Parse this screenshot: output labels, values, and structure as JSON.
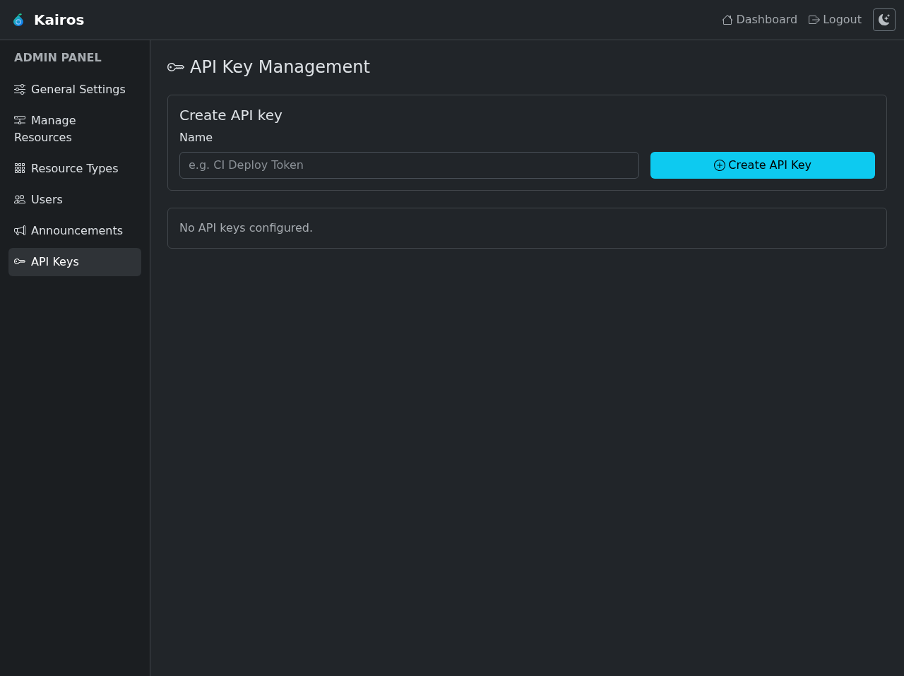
{
  "navbar": {
    "brand": "Kairos",
    "links": [
      {
        "label": "Dashboard"
      },
      {
        "label": "Logout"
      }
    ]
  },
  "sidebar": {
    "heading": "ADMIN PANEL",
    "items": [
      {
        "label": "General Settings",
        "selected": false
      },
      {
        "label": "Manage Resources",
        "selected": false
      },
      {
        "label": "Resource Types",
        "selected": false
      },
      {
        "label": "Users",
        "selected": false
      },
      {
        "label": "Announcements",
        "selected": false
      },
      {
        "label": "API Keys",
        "selected": true
      }
    ]
  },
  "main": {
    "title": "API Key Management",
    "create_card": {
      "title": "Create API key",
      "field": {
        "label": "Name",
        "placeholder": "e.g. CI Deploy Token"
      },
      "button": "Create API Key"
    },
    "keys_card": {
      "empty_message": "No API keys configured."
    }
  }
}
